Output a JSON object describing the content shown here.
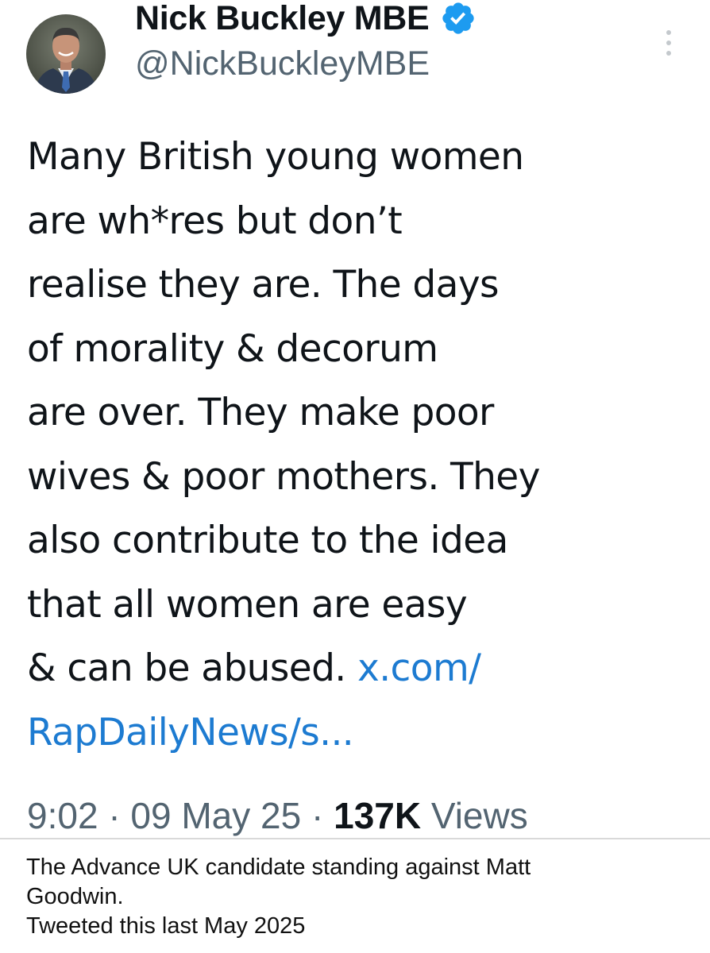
{
  "tweet": {
    "display_name": "Nick Buckley MBE",
    "handle": "@NickBuckleyMBE",
    "body_lines": [
      "Many British young women",
      "are wh*res but don’t",
      "realise they are. The days",
      "of morality & decorum",
      "are over. They make poor",
      "wives & poor mothers. They",
      "also contribute to the idea",
      "that all women are easy"
    ],
    "last_line_text": "& can be abused. ",
    "link_part1": "x.com/",
    "link_part2": "RapDailyNews/s...",
    "time": "9:02",
    "separator": "·",
    "date": "09 May 25",
    "views_count": "137K",
    "views_label": "Views",
    "icons": {
      "verified": "verified-badge-icon",
      "more": "more-options-icon"
    },
    "colors": {
      "link": "#1d7bd1",
      "verified": "#1d9bf0",
      "secondary": "#536471"
    }
  },
  "caption": {
    "lines": [
      "The Advance UK candidate standing against Matt",
      "Goodwin.",
      "Tweeted this last May 2025"
    ]
  }
}
